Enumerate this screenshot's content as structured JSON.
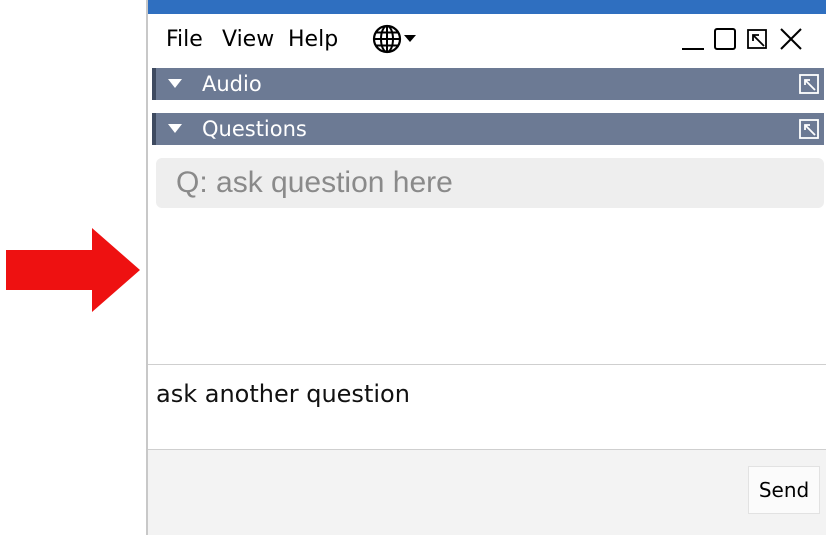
{
  "menu": {
    "file": "File",
    "view": "View",
    "help": "Help"
  },
  "sections": {
    "audio": "Audio",
    "questions": "Questions"
  },
  "questions": {
    "placeholder": "Q: ask question here"
  },
  "compose": {
    "text": "ask another question",
    "send_label": "Send"
  },
  "colors": {
    "section_bar": "#6c7a94",
    "annotation_arrow": "#ee1111",
    "title_strip": "#2f6fc0"
  }
}
